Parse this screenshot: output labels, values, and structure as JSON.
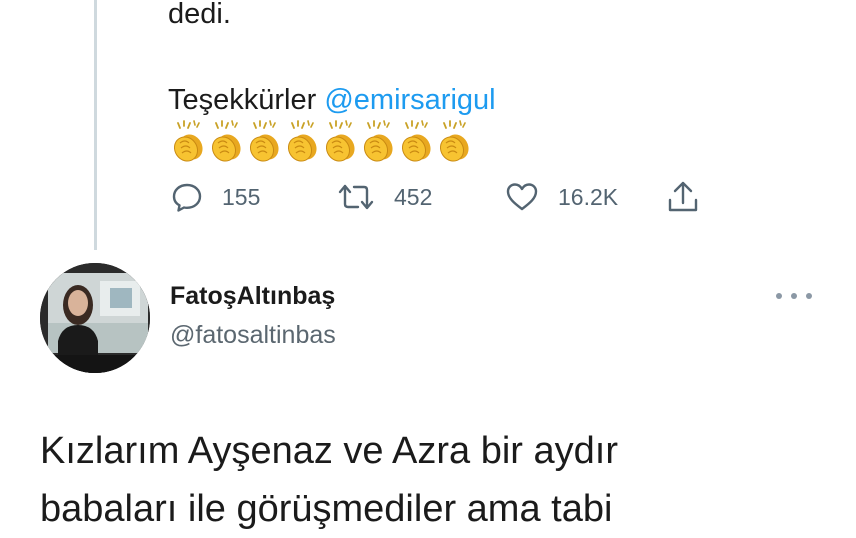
{
  "previous_tweet": {
    "text_line": "dedi.",
    "thanks_text": "Teşekkürler",
    "mention": "@emirsarigul",
    "emoji": "clapping-hands",
    "emoji_count": 8,
    "actions": {
      "reply_count": "155",
      "retweet_count": "452",
      "like_count": "16.2K"
    }
  },
  "tweet": {
    "author": {
      "display_name": "FatoşAltınbaş",
      "handle": "@fatosaltinbas"
    },
    "body_lines": [
      "Kızlarım Ayşenaz ve Azra bir aydır",
      "babaları ile görüşmediler ama tabi"
    ]
  },
  "colors": {
    "link": "#1d9bf0",
    "muted": "#536471",
    "thread_line": "#cfd9de"
  }
}
